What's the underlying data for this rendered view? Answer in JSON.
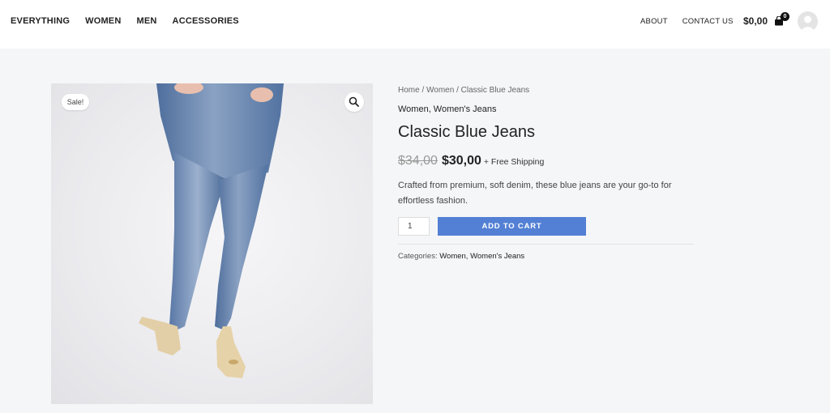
{
  "header": {
    "nav_left": [
      "EVERYTHING",
      "WOMEN",
      "MEN",
      "ACCESSORIES"
    ],
    "nav_right": [
      "ABOUT",
      "CONTACT US"
    ],
    "cart_total": "$0,00",
    "cart_count": "0"
  },
  "product": {
    "sale_badge": "Sale!",
    "breadcrumb": {
      "home": "Home",
      "sep1": " / ",
      "women": "Women",
      "sep2": " / ",
      "current": "Classic Blue Jeans"
    },
    "categories_top": "Women, Women's Jeans",
    "title": "Classic Blue Jeans",
    "price_old": "$34,00",
    "price_new": "$30,00",
    "shipping": "+ Free Shipping",
    "description": "Crafted from premium, soft denim, these blue jeans are your go-to for effortless fashion.",
    "quantity": "1",
    "add_to_cart": "ADD TO CART",
    "meta_label": "Categories:",
    "meta_categories": "Women, Women's Jeans"
  },
  "icons": {
    "zoom": "magnifier-icon",
    "cart": "cart-icon",
    "avatar": "user-avatar"
  }
}
